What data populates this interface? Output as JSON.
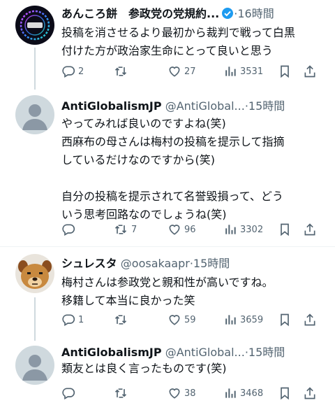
{
  "tweets": [
    {
      "display_name": "あんころ餅　参政党の党規約...",
      "handle": "",
      "time": "16時間",
      "verified": true,
      "text": "投稿を消させるより最初から裁判で戦って白黒\n付けた方が政治家生命にとって良いと思う",
      "replies": "2",
      "retweets": "",
      "likes": "27",
      "views": "3531",
      "avatar": "audio-logo"
    },
    {
      "display_name": "AntiGlobalismJP",
      "handle": "@AntiGlobal...",
      "time": "15時間",
      "verified": false,
      "text": "やってみれば良いのですよね(笑)\n西麻布の母さんは梅村の投稿を提示して指摘\nしているだけなのですから(笑)\n\n自分の投稿を提示されて名誉毀損って、どう\nいう思考回路なのでしょうね(笑)",
      "replies": "",
      "retweets": "7",
      "likes": "96",
      "views": "3302",
      "avatar": "default-profile"
    },
    {
      "display_name": "シュレスタ",
      "handle": "@oosakaapr",
      "time": "15時間",
      "verified": false,
      "text": "梅村さんは参政党と親和性が高いですね。\n移籍して本当に良かった笑",
      "replies": "1",
      "retweets": "",
      "likes": "59",
      "views": "3659",
      "avatar": "bear-face"
    },
    {
      "display_name": "AntiGlobalismJP",
      "handle": "@AntiGlobal...",
      "time": "15時間",
      "verified": false,
      "text": "類友とは良く言ったものです(笑)",
      "replies": "",
      "retweets": "",
      "likes": "38",
      "views": "3468",
      "avatar": "default-profile"
    }
  ],
  "separator": "·",
  "colors": {
    "text": "#0f1419",
    "muted": "#536471",
    "verified": "#1d9bf0",
    "thread_line": "#cfd9de",
    "divider": "#eff3f4"
  }
}
